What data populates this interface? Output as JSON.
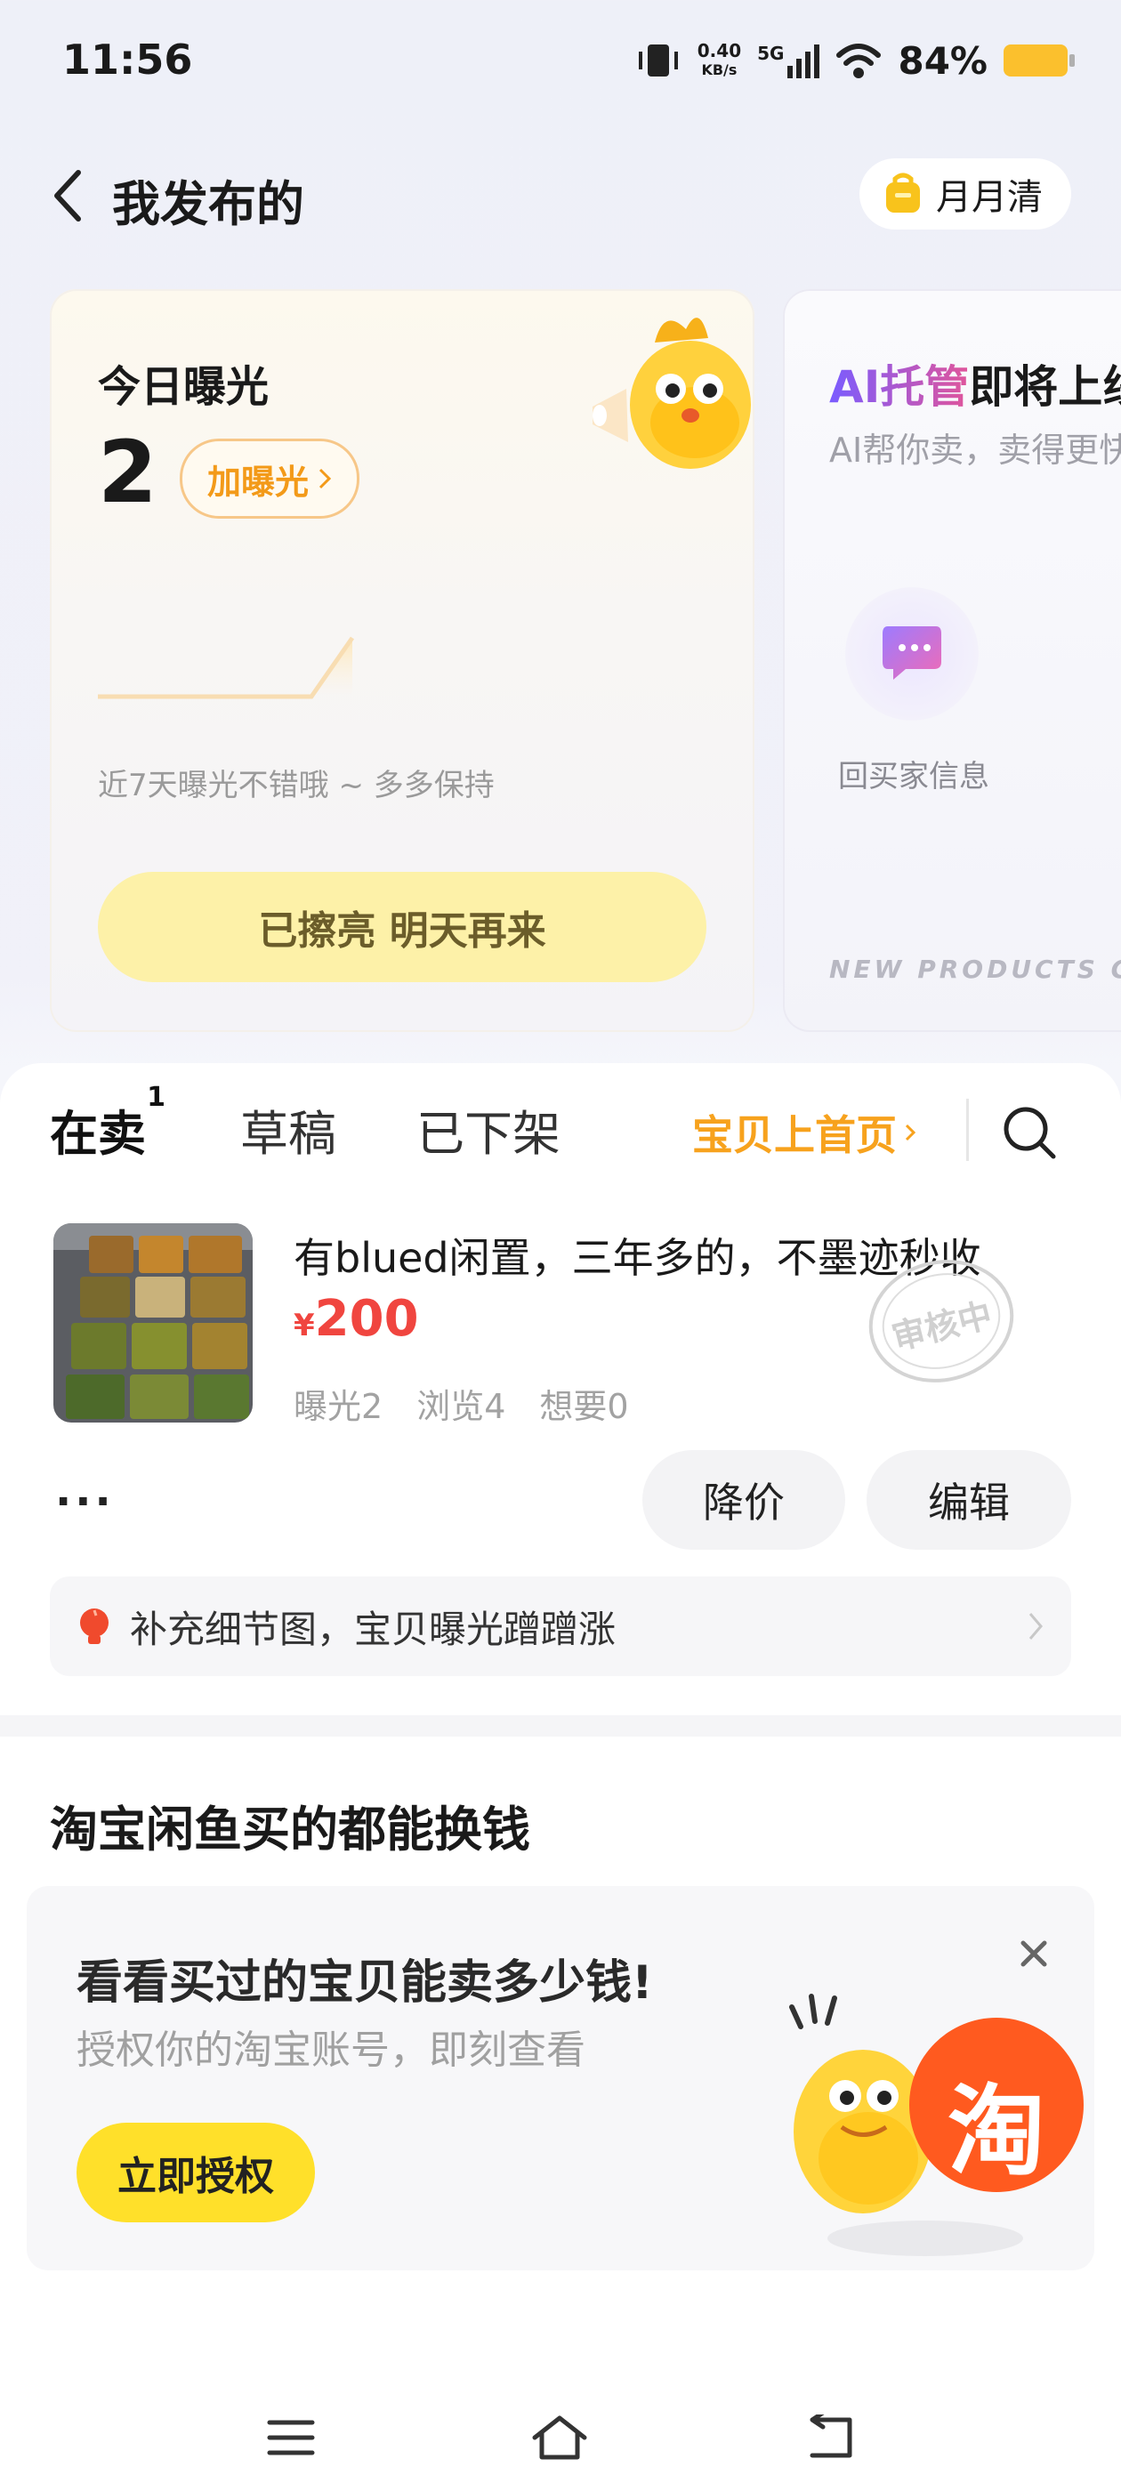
{
  "status_bar": {
    "time": "11:56",
    "net_speed_value": "0.40",
    "net_speed_unit": "KB/s",
    "network": "5G",
    "battery_percent": "84%"
  },
  "header": {
    "title": "我发布的",
    "pill_label": "月月清"
  },
  "exposure_card": {
    "title": "今日曝光",
    "value": "2",
    "boost_label": "加曝光",
    "note": "近7天曝光不错哦 ~ 多多保持",
    "cta": "已擦亮 明天再来"
  },
  "ai_card": {
    "title_highlight": "AI托管",
    "title_rest": "即将上线",
    "subtitle": "AI帮你卖，卖得更快",
    "icon_label": "回买家信息",
    "footer": "NEW PRODUCTS COMING"
  },
  "tabs": [
    {
      "label": "在卖",
      "badge": "1"
    },
    {
      "label": "草稿"
    },
    {
      "label": "已下架"
    }
  ],
  "promo_link": "宝贝上首页",
  "listing": {
    "title": "有blued闲置，三年多的，不墨迹秒收",
    "currency": "¥",
    "price": "200",
    "stats": {
      "exposure": "曝光2",
      "views": "浏览4",
      "wants": "想要0"
    },
    "stamp": "审核中",
    "more": "···",
    "reduce_price": "降价",
    "edit": "编辑",
    "tip": "补充细节图，宝贝曝光蹭蹭涨"
  },
  "taobao_section": {
    "title": "淘宝闲鱼买的都能换钱",
    "card_title": "看看买过的宝贝能卖多少钱!",
    "card_sub": "授权你的淘宝账号，即刻查看",
    "button": "立即授权",
    "logo_char": "淘"
  },
  "icons": [
    "back-arrow-icon",
    "gold-bag-icon",
    "chevron-right-icon",
    "search-icon",
    "chat-bubble-icon",
    "lightbulb-icon",
    "close-icon",
    "menu-icon",
    "home-icon",
    "back-nav-icon"
  ],
  "colors": {
    "accent_orange": "#f39a19",
    "price_red": "#f0453f",
    "yellow": "#ffe02a",
    "taobao_orange": "#ff5a1f"
  }
}
